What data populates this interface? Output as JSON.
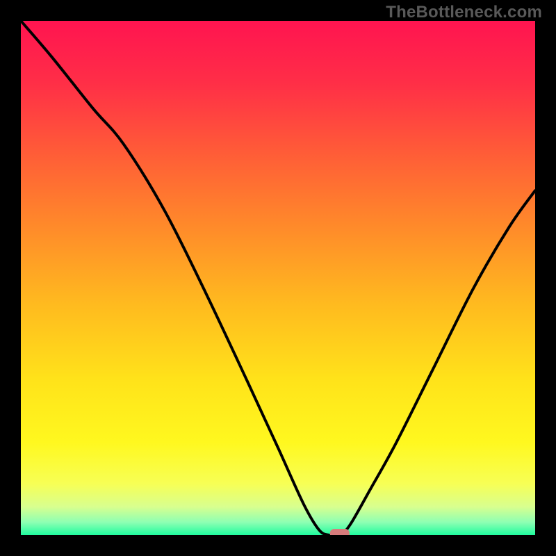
{
  "watermark": "TheBottleneck.com",
  "colors": {
    "page_bg": "#000000",
    "curve": "#000000",
    "marker_fill": "#d77c7c",
    "gradient_stops": [
      {
        "offset": 0.0,
        "color": "#ff1450"
      },
      {
        "offset": 0.12,
        "color": "#ff2e47"
      },
      {
        "offset": 0.25,
        "color": "#ff5a38"
      },
      {
        "offset": 0.4,
        "color": "#ff8a2a"
      },
      {
        "offset": 0.55,
        "color": "#ffba1f"
      },
      {
        "offset": 0.7,
        "color": "#ffe31a"
      },
      {
        "offset": 0.82,
        "color": "#fff81f"
      },
      {
        "offset": 0.9,
        "color": "#f7ff55"
      },
      {
        "offset": 0.945,
        "color": "#d8ff8f"
      },
      {
        "offset": 0.975,
        "color": "#8dffb3"
      },
      {
        "offset": 1.0,
        "color": "#1efb9e"
      }
    ]
  },
  "chart_data": {
    "type": "line",
    "title": "",
    "xlabel": "",
    "ylabel": "",
    "xlim": [
      0,
      100
    ],
    "ylim": [
      0,
      100
    ],
    "x": [
      0,
      6,
      14,
      20,
      28,
      36,
      44,
      50,
      55,
      58,
      60,
      62,
      64,
      68,
      73,
      80,
      88,
      95,
      100
    ],
    "values": [
      100,
      93,
      83,
      76,
      63,
      47,
      30,
      17,
      6,
      1,
      0,
      0,
      2,
      9,
      18,
      32,
      48,
      60,
      67
    ],
    "marker": {
      "x": 62,
      "y": 0
    }
  }
}
